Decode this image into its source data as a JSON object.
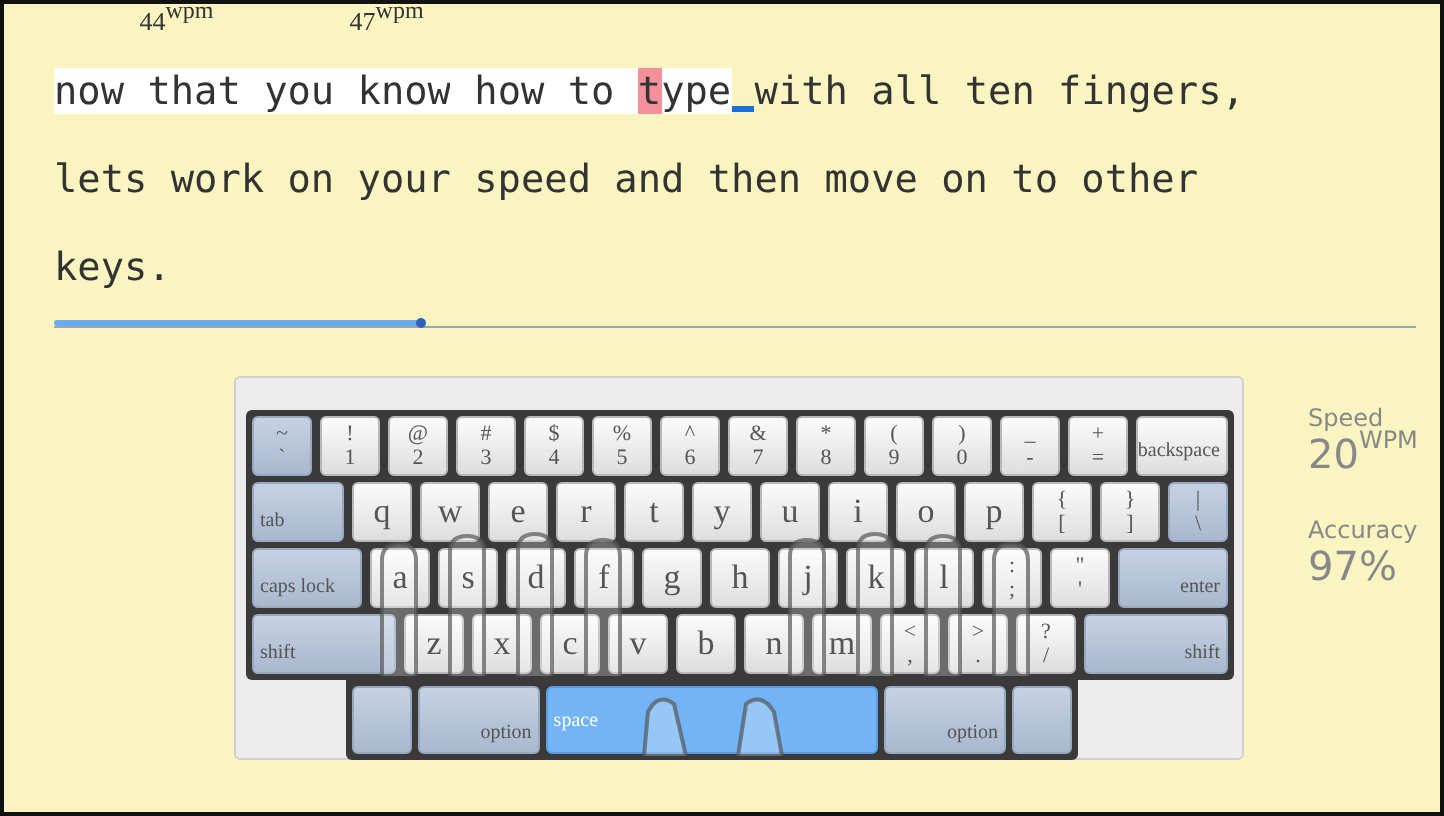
{
  "passage": {
    "segments": [
      {
        "text": "now ",
        "kind": "typed"
      },
      {
        "text": "that",
        "kind": "typed",
        "wpm": "44",
        "wpm_unit": "wpm"
      },
      {
        "text": " you ",
        "kind": "typed"
      },
      {
        "text": "know",
        "kind": "typed",
        "wpm": "47",
        "wpm_unit": "wpm"
      },
      {
        "text": " how to ",
        "kind": "typed"
      },
      {
        "text": "t",
        "kind": "error"
      },
      {
        "text": "ype",
        "kind": "typed"
      },
      {
        "kind": "cursor"
      },
      {
        "text": " with all ten fingers, lets work on your speed and then move on to other keys.",
        "kind": "pending"
      }
    ]
  },
  "progress": {
    "level": 0.27
  },
  "keyboard": {
    "rows": [
      {
        "keys": [
          {
            "kind": "tint",
            "shift": "~",
            "label": "`",
            "next": false
          },
          {
            "kind": "symbol",
            "shift": "!",
            "label": "1",
            "next": false
          },
          {
            "kind": "symbol",
            "shift": "@",
            "label": "2",
            "next": false
          },
          {
            "kind": "symbol",
            "shift": "#",
            "label": "3",
            "next": false
          },
          {
            "kind": "symbol",
            "shift": "$",
            "label": "4",
            "next": false
          },
          {
            "kind": "symbol",
            "shift": "%",
            "label": "5",
            "next": false
          },
          {
            "kind": "symbol",
            "shift": "^",
            "label": "6",
            "next": false
          },
          {
            "kind": "symbol",
            "shift": "&",
            "label": "7",
            "next": false
          },
          {
            "kind": "symbol",
            "shift": "*",
            "label": "8",
            "next": false
          },
          {
            "kind": "symbol",
            "shift": "(",
            "label": "9",
            "next": false
          },
          {
            "kind": "symbol",
            "shift": ")",
            "label": "0",
            "next": false
          },
          {
            "kind": "symbol",
            "shift": "_",
            "label": "-",
            "next": false
          },
          {
            "kind": "symbol",
            "shift": "+",
            "label": "=",
            "next": false
          },
          {
            "kind": "wide",
            "label": "backspace",
            "next": false
          }
        ]
      },
      {
        "keys": [
          {
            "kind": "modifier",
            "label": "tab",
            "next": false
          },
          {
            "kind": "letter",
            "label": "q",
            "next": false
          },
          {
            "kind": "letter",
            "label": "w",
            "next": false
          },
          {
            "kind": "letter",
            "label": "e",
            "next": false
          },
          {
            "kind": "letter",
            "label": "r",
            "next": false
          },
          {
            "kind": "letter",
            "label": "t",
            "next": false
          },
          {
            "kind": "letter",
            "label": "y",
            "next": false
          },
          {
            "kind": "letter",
            "label": "u",
            "next": false
          },
          {
            "kind": "letter",
            "label": "i",
            "next": false
          },
          {
            "kind": "letter",
            "label": "o",
            "next": false
          },
          {
            "kind": "letter",
            "label": "p",
            "next": false
          },
          {
            "kind": "symbol",
            "shift": "{",
            "label": "[",
            "next": false
          },
          {
            "kind": "symbol",
            "shift": "}",
            "label": "]",
            "next": false
          },
          {
            "kind": "tint",
            "shift": "|",
            "label": "\\",
            "next": false
          }
        ]
      },
      {
        "keys": [
          {
            "kind": "modifier",
            "label": "caps lock",
            "next": false
          },
          {
            "kind": "letter",
            "label": "a",
            "next": false
          },
          {
            "kind": "letter",
            "label": "s",
            "next": false
          },
          {
            "kind": "letter",
            "label": "d",
            "next": false
          },
          {
            "kind": "letter",
            "label": "f",
            "next": false
          },
          {
            "kind": "letter",
            "label": "g",
            "next": false
          },
          {
            "kind": "letter",
            "label": "h",
            "next": false
          },
          {
            "kind": "letter",
            "label": "j",
            "next": false
          },
          {
            "kind": "letter",
            "label": "k",
            "next": false
          },
          {
            "kind": "letter",
            "label": "l",
            "next": false
          },
          {
            "kind": "symbol",
            "shift": ":",
            "label": ";",
            "next": false
          },
          {
            "kind": "symbol",
            "shift": "\"",
            "label": "'",
            "next": false
          },
          {
            "kind": "modifier",
            "label": "enter",
            "next": false
          }
        ]
      },
      {
        "keys": [
          {
            "kind": "modifier",
            "label": "shift",
            "next": false
          },
          {
            "kind": "letter",
            "label": "z",
            "next": false
          },
          {
            "kind": "letter",
            "label": "x",
            "next": false
          },
          {
            "kind": "letter",
            "label": "c",
            "next": false
          },
          {
            "kind": "letter",
            "label": "v",
            "next": false
          },
          {
            "kind": "letter",
            "label": "b",
            "next": false
          },
          {
            "kind": "letter",
            "label": "n",
            "next": false
          },
          {
            "kind": "letter",
            "label": "m",
            "next": false
          },
          {
            "kind": "symbol",
            "shift": "<",
            "label": ",",
            "next": false
          },
          {
            "kind": "symbol",
            "shift": ">",
            "label": ".",
            "next": false
          },
          {
            "kind": "symbol",
            "shift": "?",
            "label": "/",
            "next": false
          },
          {
            "kind": "modifier",
            "label": "shift",
            "next": false
          }
        ]
      },
      {
        "keys": [
          {
            "kind": "tint",
            "next": false
          },
          {
            "kind": "modifier",
            "label": "option",
            "next": false
          },
          {
            "kind": "space",
            "label": "space",
            "next": true
          },
          {
            "kind": "modifier",
            "label": "option",
            "next": false
          },
          {
            "kind": "tint",
            "next": false
          }
        ]
      }
    ]
  },
  "stats": [
    {
      "label": "Speed",
      "value": "20",
      "unit": "WPM"
    },
    {
      "label": "Accuracy",
      "value": "97%"
    }
  ]
}
